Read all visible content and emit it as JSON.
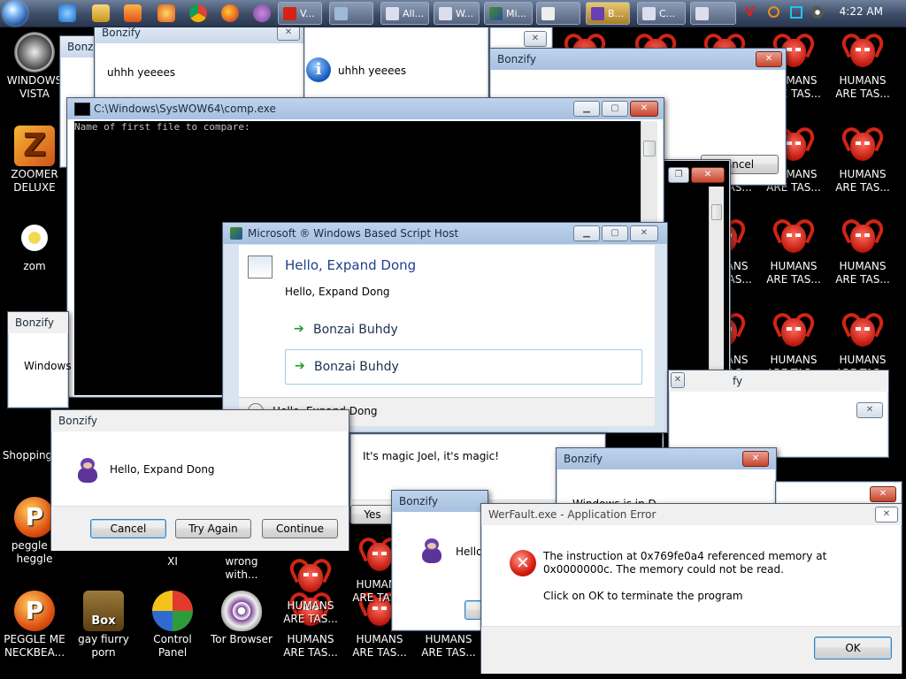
{
  "taskbar": {
    "tasks": [
      {
        "label": "V..."
      },
      {
        "label": ""
      },
      {
        "label": "All..."
      },
      {
        "label": "W..."
      },
      {
        "label": "Mi..."
      },
      {
        "label": ""
      },
      {
        "label": "B..."
      },
      {
        "label": "C..."
      },
      {
        "label": ""
      }
    ],
    "clock": "4:22 AM"
  },
  "desktop": {
    "icons": [
      {
        "label": "WINDOWS VISTA"
      },
      {
        "label": "ZOOMER DELUXE"
      },
      {
        "label": "zom"
      },
      {
        "label": "Shopping"
      },
      {
        "label": "peggle n heggle"
      },
      {
        "label": "XI"
      },
      {
        "label": "wrong with..."
      },
      {
        "label": "PEGGLE ME NECKBEA..."
      },
      {
        "label": "gay fiurry porn"
      },
      {
        "label": "Control Panel"
      },
      {
        "label": "Tor Browser"
      }
    ],
    "devil_label": "HUMANS ARE TAS...",
    "devil_label_partial": "ARE TAS..."
  },
  "windows": {
    "bonzify_a": {
      "title": "Bonzify",
      "message": "uhhh yeeees",
      "partial_title": "Bonzi"
    },
    "info_msg": {
      "message": "uhhh yeeees"
    },
    "bonzify_b": {
      "title": "Bonzify",
      "cancel_partial": "ancel"
    },
    "console": {
      "title": "C:\\Windows\\SysWOW64\\comp.exe",
      "text": "Name of first file to compare:"
    },
    "wsh": {
      "title": "Microsoft ® Windows Based Script Host",
      "heading": "Hello, Expand Dong",
      "body": "Hello, Expand Dong",
      "option1": "Bonzai Buhdy",
      "option2": "Bonzai Buhdy",
      "details": "Hello, Expand Dong"
    },
    "bonzify_c": {
      "title": "Bonzify",
      "text_partial": "Windows"
    },
    "bonzify_d": {
      "title": "Bonzify",
      "message": "Hello, Expand Dong",
      "cancel": "Cancel",
      "try_again": "Try Again",
      "continue": "Continue"
    },
    "magic": {
      "message": "It's magic Joel, it's magic!",
      "yes_partial": "Yes"
    },
    "bonzify_e": {
      "title": "Bonzify",
      "text_partial": "Windows is in D..."
    },
    "bonzify_f": {
      "title": "Bonzify",
      "text_partial": "Hello"
    },
    "bonzify_g": {
      "title_partial": "fy"
    },
    "werfault": {
      "title": "WerFault.exe - Application Error",
      "message": "The instruction at 0x769fe0a4 referenced memory at 0x0000000c. The memory could not be read.",
      "message2": "Click on OK to terminate the program",
      "ok": "OK"
    }
  },
  "colors": {
    "error_red": "#d61c0e",
    "accent_blue": "#3c7fb1",
    "console_bg": "#000000"
  }
}
